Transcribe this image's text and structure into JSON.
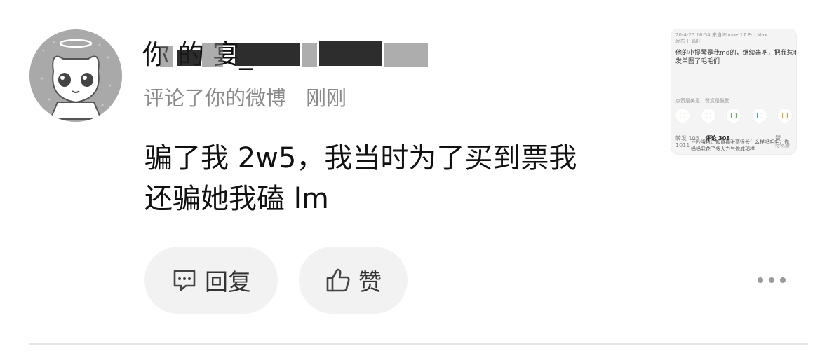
{
  "notification": {
    "username_visible": "你                       的                                   宴_",
    "action_text": "评论了你的微博",
    "time_text": "刚刚",
    "comment_line1": "骗了我 2w5，我当时为了买到票我",
    "comment_line2": "还骗她我磕 lm"
  },
  "actions": {
    "reply_label": "回复",
    "like_label": "赞"
  },
  "thumbnail": {
    "header": "20-4-25 16:54  来自iPhone 17 Pro Max",
    "subheader": "发布于 四川",
    "post_line1": "他的小提琴是我md的，继续蛊吧，把我惹毛了我就",
    "post_line2": "发单图了毛毛们",
    "footer_hint": "点赞是美意，赞赏是鼓励",
    "tab_repost": "转发 105",
    "tab_comment": "评论 308",
    "tab_like": "赞 1011",
    "sort_label": "按热度",
    "reply_line1": "还吵哦粉，知道那张票很长什么样吗毛毛，你",
    "reply_line2": "妈妈我花了多大力气修成那样",
    "icon_names": [
      "gift-icon",
      "chat-icon",
      "wechat-icon",
      "qq-icon",
      "note-icon"
    ]
  },
  "colors": {
    "avatar_bg": "#a9a9a9",
    "pill_bg": "#f2f2f2",
    "meta_text": "#8a8a8a",
    "icon_accent": "#f0a020"
  }
}
